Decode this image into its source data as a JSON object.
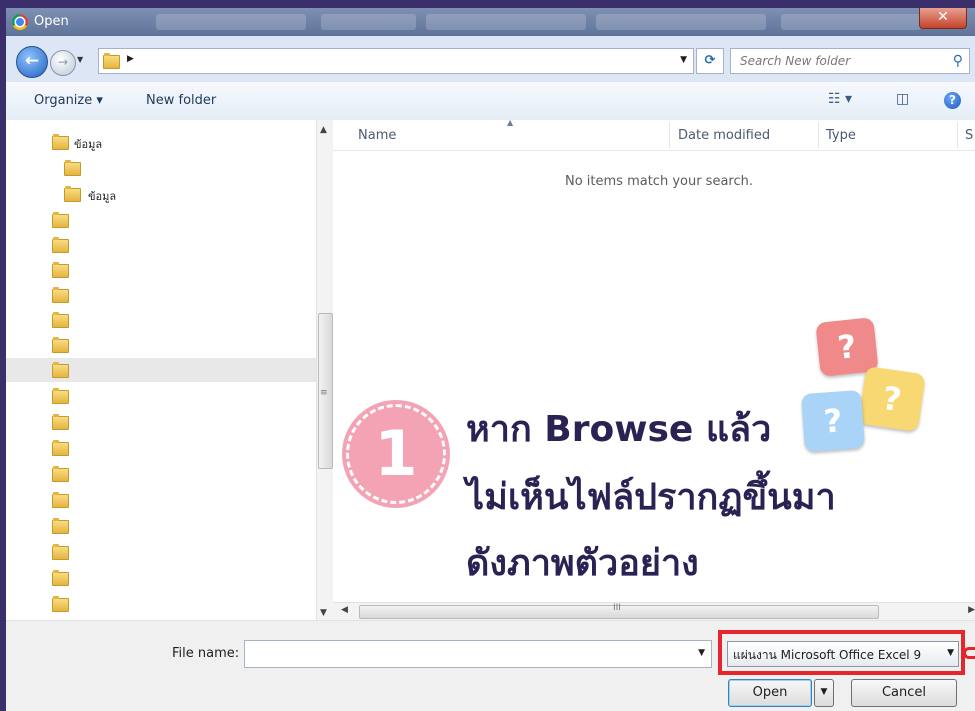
{
  "window": {
    "title": "Open"
  },
  "address": {
    "search_placeholder": "Search New folder"
  },
  "toolbar": {
    "organize": "Organize ▾",
    "new_folder": "New folder"
  },
  "nav_tree": {
    "items": [
      {
        "label": "ข้อมูล"
      },
      {
        "label": ""
      },
      {
        "label": "ข้อมูล"
      }
    ]
  },
  "file_list": {
    "columns": [
      "Name",
      "Date modified",
      "Type",
      "S"
    ],
    "empty_message": "No items match your search."
  },
  "bottom": {
    "file_name_label": "File name:",
    "file_name_value": "",
    "file_type_value": "แผ่นงาน Microsoft Office Excel 9",
    "open_label": "Open",
    "cancel_label": "Cancel"
  },
  "annotation": {
    "number": "1",
    "lines": [
      "หาก Browse แล้ว",
      "ไม่เห็นไฟล์ปรากฏขึ้นมา",
      "ดังภาพตัวอย่าง"
    ],
    "accent_color": "#e5262c",
    "badge_color": "#f4a3b4"
  },
  "icons": {
    "back": "arrow-left-icon",
    "forward": "arrow-right-icon",
    "refresh": "refresh-icon",
    "search": "search-icon",
    "help": "help-icon",
    "close": "close-icon"
  }
}
